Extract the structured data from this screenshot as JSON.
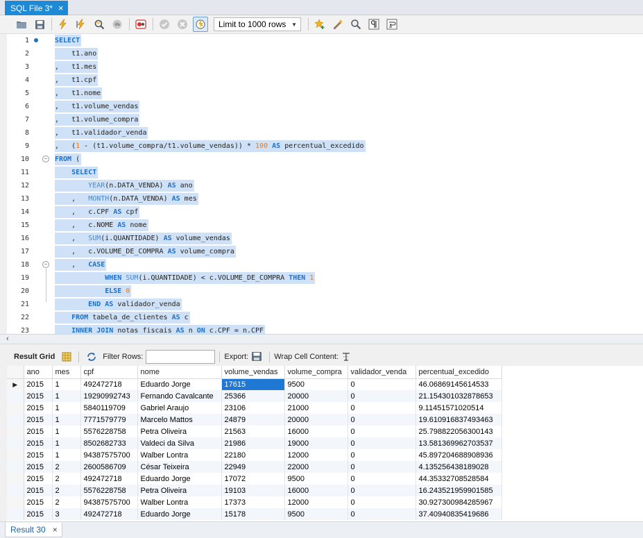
{
  "tabs": [
    {
      "title": "SQL File 3*",
      "close": "×"
    }
  ],
  "toolbar": {
    "limit_label": "Limit to 1000 rows",
    "icons": [
      "folder-open-icon",
      "save-icon",
      "execute-icon",
      "execute-statement-icon",
      "explain-icon",
      "stop-icon",
      "toggle-error-icon",
      "commit-icon",
      "rollback-icon",
      "autocommit-icon",
      "add-snippet-icon",
      "beautify-icon",
      "find-icon",
      "invisible-chars-icon",
      "wrap-icon"
    ]
  },
  "editor": {
    "lines": [
      "1",
      "2",
      "3",
      "4",
      "5",
      "6",
      "7",
      "8",
      "9",
      "10",
      "11",
      "12",
      "13",
      "14",
      "15",
      "16",
      "17",
      "18",
      "19",
      "20",
      "21",
      "22",
      "23"
    ],
    "code": {
      "l1": "SELECT",
      "l2": "t1.ano",
      "l3": "t1.mes",
      "l4": "t1.cpf",
      "l5": "t1.nome",
      "l6": "t1.volume_vendas",
      "l7": "t1.volume_compra",
      "l8": "t1.validador_venda",
      "l9a": "(",
      "l9b": "1",
      "l9c": " - (t1.volume_compra/t1.volume_vendas)) * ",
      "l9d": "100",
      "l9e": "AS",
      "l9f": " percentual_excedido",
      "l10a": "FROM",
      "l10b": " (",
      "l11": "SELECT",
      "l12a": "YEAR",
      "l12b": "(n.DATA_VENDA) ",
      "l12c": "AS",
      "l12d": " ano",
      "l13a": "MONTH",
      "l13b": "(n.DATA_VENDA) ",
      "l13c": "AS",
      "l13d": " mes",
      "l14a": "c.CPF ",
      "l14b": "AS",
      "l14c": " cpf",
      "l15a": "c.NOME ",
      "l15b": "AS",
      "l15c": " nome",
      "l16a": "SUM",
      "l16b": "(i.QUANTIDADE) ",
      "l16c": "AS",
      "l16d": " volume_vendas",
      "l17a": "c.VOLUME_DE_COMPRA ",
      "l17b": "AS",
      "l17c": " volume_compra",
      "l18": "CASE",
      "l19a": "WHEN",
      "l19b": "SUM",
      "l19c": "(i.QUANTIDADE) < c.VOLUME_DE_COMPRA ",
      "l19d": "THEN",
      "l19e": "1",
      "l20a": "ELSE",
      "l20b": "0",
      "l21a": "END",
      "l21b": "AS",
      "l21c": " validador_venda",
      "l22a": "FROM",
      "l22b": " tabela_de_clientes ",
      "l22c": "AS",
      "l22d": " c",
      "l23a": "INNER JOIN",
      "l23b": " notas_fiscais ",
      "l23c": "AS",
      "l23d": " n ",
      "l23e": "ON",
      "l23f": " c.CPF = n.CPF",
      "comma": ","
    }
  },
  "result_toolbar": {
    "result_grid": "Result Grid",
    "filter_rows": "Filter Rows:",
    "export": "Export:",
    "wrap": "Wrap Cell Content:"
  },
  "grid": {
    "columns": [
      "ano",
      "mes",
      "cpf",
      "nome",
      "volume_vendas",
      "volume_compra",
      "validador_venda",
      "percentual_excedido"
    ],
    "rows": [
      [
        "2015",
        "1",
        "492472718",
        "Eduardo Jorge",
        "17615",
        "9500",
        "0",
        "46.06869145614533"
      ],
      [
        "2015",
        "1",
        "19290992743",
        "Fernando Cavalcante",
        "25366",
        "20000",
        "0",
        "21.154301032878653"
      ],
      [
        "2015",
        "1",
        "5840119709",
        "Gabriel Araujo",
        "23106",
        "21000",
        "0",
        "9.11451571020514"
      ],
      [
        "2015",
        "1",
        "7771579779",
        "Marcelo Mattos",
        "24879",
        "20000",
        "0",
        "19.610916837493463"
      ],
      [
        "2015",
        "1",
        "5576228758",
        "Petra Oliveira",
        "21563",
        "16000",
        "0",
        "25.798822056300143"
      ],
      [
        "2015",
        "1",
        "8502682733",
        "Valdeci da Silva",
        "21986",
        "19000",
        "0",
        "13.581369962703537"
      ],
      [
        "2015",
        "1",
        "94387575700",
        "Walber Lontra",
        "22180",
        "12000",
        "0",
        "45.897204688908936"
      ],
      [
        "2015",
        "2",
        "2600586709",
        "César Teixeira",
        "22949",
        "22000",
        "0",
        "4.135256438189028"
      ],
      [
        "2015",
        "2",
        "492472718",
        "Eduardo Jorge",
        "17072",
        "9500",
        "0",
        "44.35332708528584"
      ],
      [
        "2015",
        "2",
        "5576228758",
        "Petra Oliveira",
        "19103",
        "16000",
        "0",
        "16.243521959901585"
      ],
      [
        "2015",
        "2",
        "94387575700",
        "Walber Lontra",
        "17373",
        "12000",
        "0",
        "30.927300984285967"
      ],
      [
        "2015",
        "3",
        "492472718",
        "Eduardo Jorge",
        "15178",
        "9500",
        "0",
        "37.40940835419686"
      ]
    ]
  },
  "bottom_tabs": [
    {
      "title": "Result 30",
      "close": "×"
    }
  ],
  "colors": {
    "accent": "#1e8ad6",
    "selection": "#1e78d4",
    "keyword": "#1d6fc7",
    "number": "#e07b2c",
    "highlight": "#cfe1f6"
  }
}
